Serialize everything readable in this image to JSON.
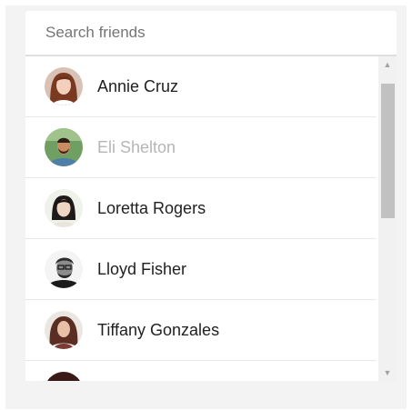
{
  "search": {
    "placeholder": "Search friends",
    "value": ""
  },
  "friends": [
    {
      "name": "Annie Cruz",
      "disabled": false,
      "avatar": "woman-red-hair-avatar"
    },
    {
      "name": "Eli Shelton",
      "disabled": true,
      "avatar": "man-beard-outdoor-avatar"
    },
    {
      "name": "Loretta Rogers",
      "disabled": false,
      "avatar": "woman-dark-hair-avatar"
    },
    {
      "name": "Lloyd Fisher",
      "disabled": false,
      "avatar": "man-glasses-bw-avatar"
    },
    {
      "name": "Tiffany Gonzales",
      "disabled": false,
      "avatar": "woman-curly-hair-avatar"
    }
  ],
  "scrollbar": {
    "up_icon": "▲",
    "down_icon": "▼"
  },
  "colors": {
    "panel_bg": "#f3f3f3",
    "text": "#212121",
    "disabled_text": "#b6b6b6",
    "placeholder": "#757575",
    "thumb": "#c1c1c1"
  }
}
